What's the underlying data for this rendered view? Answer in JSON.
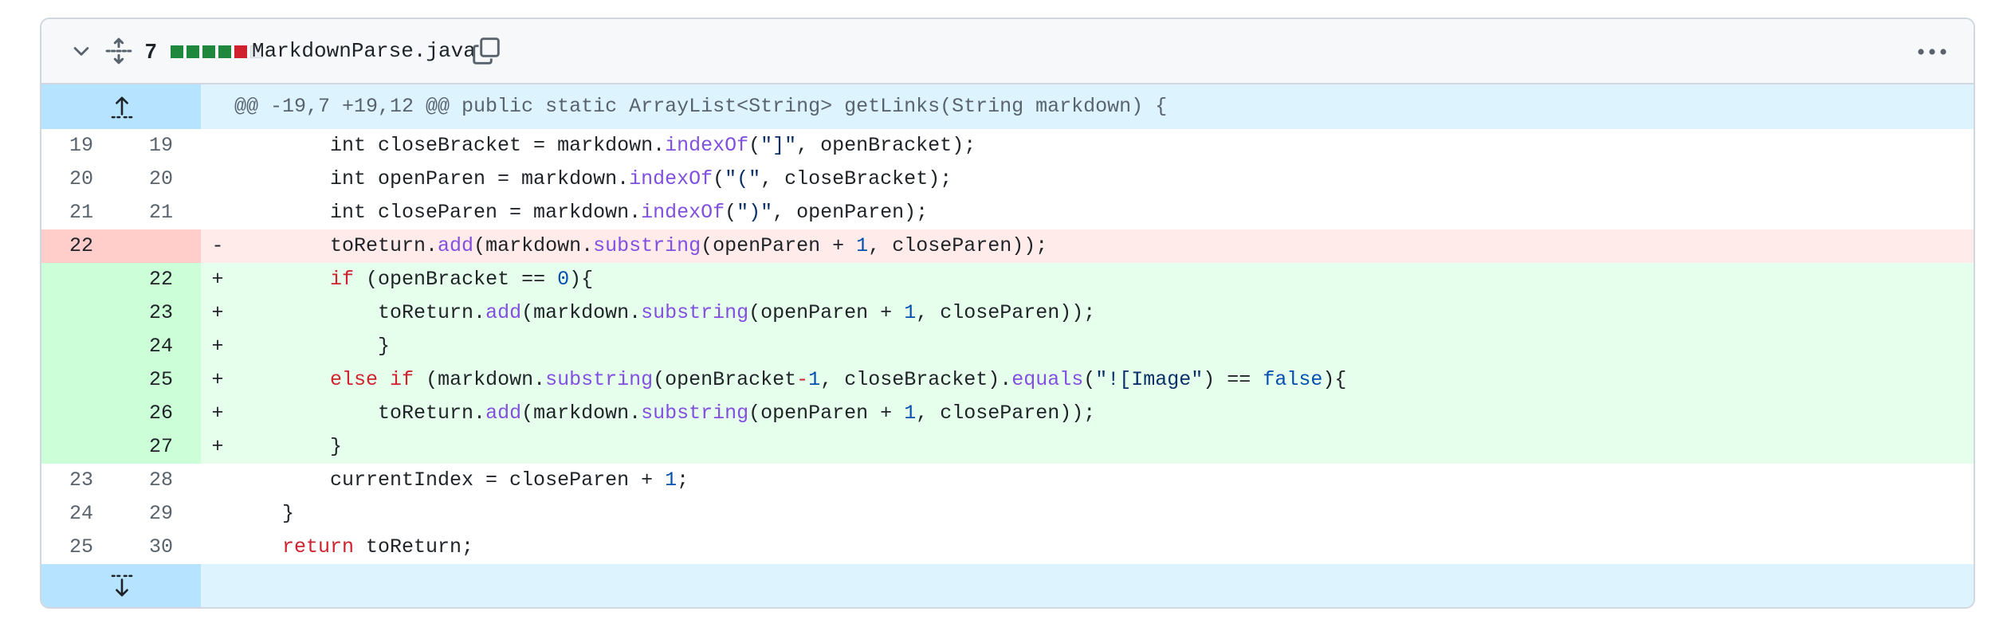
{
  "file": {
    "changes": "7",
    "diffstat": [
      "add",
      "add",
      "add",
      "add",
      "del",
      "neutral"
    ],
    "name": "MarkdownParse.java"
  },
  "hunk_header": "@@ -19,7 +19,12 @@ public static ArrayList<String> getLinks(String markdown) {",
  "lines": [
    {
      "type": "ctx",
      "old": "19",
      "new": "19",
      "marker": "",
      "tokens": [
        [
          "plain",
          "        int closeBracket = markdown."
        ],
        [
          "fn",
          "indexOf"
        ],
        [
          "plain",
          "("
        ],
        [
          "str",
          "\"]\""
        ],
        [
          "plain",
          ", openBracket);"
        ]
      ]
    },
    {
      "type": "ctx",
      "old": "20",
      "new": "20",
      "marker": "",
      "tokens": [
        [
          "plain",
          "        int openParen = markdown."
        ],
        [
          "fn",
          "indexOf"
        ],
        [
          "plain",
          "("
        ],
        [
          "str",
          "\"(\""
        ],
        [
          "plain",
          ", closeBracket);"
        ]
      ]
    },
    {
      "type": "ctx",
      "old": "21",
      "new": "21",
      "marker": "",
      "tokens": [
        [
          "plain",
          "        int closeParen = markdown."
        ],
        [
          "fn",
          "indexOf"
        ],
        [
          "plain",
          "("
        ],
        [
          "str",
          "\")\""
        ],
        [
          "plain",
          ", openParen);"
        ]
      ]
    },
    {
      "type": "del",
      "old": "22",
      "new": "",
      "marker": "-",
      "tokens": [
        [
          "plain",
          "        toReturn."
        ],
        [
          "fn",
          "add"
        ],
        [
          "plain",
          "(markdown."
        ],
        [
          "fn",
          "substring"
        ],
        [
          "plain",
          "(openParen + "
        ],
        [
          "num",
          "1"
        ],
        [
          "plain",
          ", closeParen));"
        ]
      ]
    },
    {
      "type": "add",
      "old": "",
      "new": "22",
      "marker": "+",
      "tokens": [
        [
          "plain",
          "        "
        ],
        [
          "kw",
          "if"
        ],
        [
          "plain",
          " (openBracket == "
        ],
        [
          "num",
          "0"
        ],
        [
          "plain",
          "){"
        ]
      ]
    },
    {
      "type": "add",
      "old": "",
      "new": "23",
      "marker": "+",
      "tokens": [
        [
          "plain",
          "            toReturn."
        ],
        [
          "fn",
          "add"
        ],
        [
          "plain",
          "(markdown."
        ],
        [
          "fn",
          "substring"
        ],
        [
          "plain",
          "(openParen + "
        ],
        [
          "num",
          "1"
        ],
        [
          "plain",
          ", closeParen));"
        ]
      ]
    },
    {
      "type": "add",
      "old": "",
      "new": "24",
      "marker": "+",
      "tokens": [
        [
          "plain",
          "            }"
        ]
      ]
    },
    {
      "type": "add",
      "old": "",
      "new": "25",
      "marker": "+",
      "tokens": [
        [
          "plain",
          "        "
        ],
        [
          "kw",
          "else if"
        ],
        [
          "plain",
          " (markdown."
        ],
        [
          "fn",
          "substring"
        ],
        [
          "plain",
          "(openBracket"
        ],
        [
          "kw",
          "-"
        ],
        [
          "num",
          "1"
        ],
        [
          "plain",
          ", closeBracket)."
        ],
        [
          "fn",
          "equals"
        ],
        [
          "plain",
          "("
        ],
        [
          "str",
          "\"![Image\""
        ],
        [
          "plain",
          ") == "
        ],
        [
          "num",
          "false"
        ],
        [
          "plain",
          "){"
        ]
      ]
    },
    {
      "type": "add",
      "old": "",
      "new": "26",
      "marker": "+",
      "tokens": [
        [
          "plain",
          "            toReturn."
        ],
        [
          "fn",
          "add"
        ],
        [
          "plain",
          "(markdown."
        ],
        [
          "fn",
          "substring"
        ],
        [
          "plain",
          "(openParen + "
        ],
        [
          "num",
          "1"
        ],
        [
          "plain",
          ", closeParen));"
        ]
      ]
    },
    {
      "type": "add",
      "old": "",
      "new": "27",
      "marker": "+",
      "tokens": [
        [
          "plain",
          "        }"
        ]
      ]
    },
    {
      "type": "ctx",
      "old": "23",
      "new": "28",
      "marker": "",
      "tokens": [
        [
          "plain",
          "        currentIndex = closeParen + "
        ],
        [
          "num",
          "1"
        ],
        [
          "plain",
          ";"
        ]
      ]
    },
    {
      "type": "ctx",
      "old": "24",
      "new": "29",
      "marker": "",
      "tokens": [
        [
          "plain",
          "    }"
        ]
      ]
    },
    {
      "type": "ctx",
      "old": "25",
      "new": "30",
      "marker": "",
      "tokens": [
        [
          "plain",
          "    "
        ],
        [
          "kw",
          "return"
        ],
        [
          "plain",
          " toReturn;"
        ]
      ]
    }
  ],
  "colors": {
    "add_bg": "#e6ffec",
    "add_num_bg": "#ccffd8",
    "del_bg": "#ffebe9",
    "del_num_bg": "#ffcecb",
    "hunk_bg": "#ddf4ff",
    "hunk_expander_bg": "#b6e3ff"
  },
  "icons": {
    "collapse": "chevron-down-icon",
    "expand_all": "unfold-icon",
    "copy": "copy-icon",
    "menu": "kebab-horizontal-icon",
    "expand_up": "expand-up-icon",
    "expand_down": "expand-down-icon"
  }
}
